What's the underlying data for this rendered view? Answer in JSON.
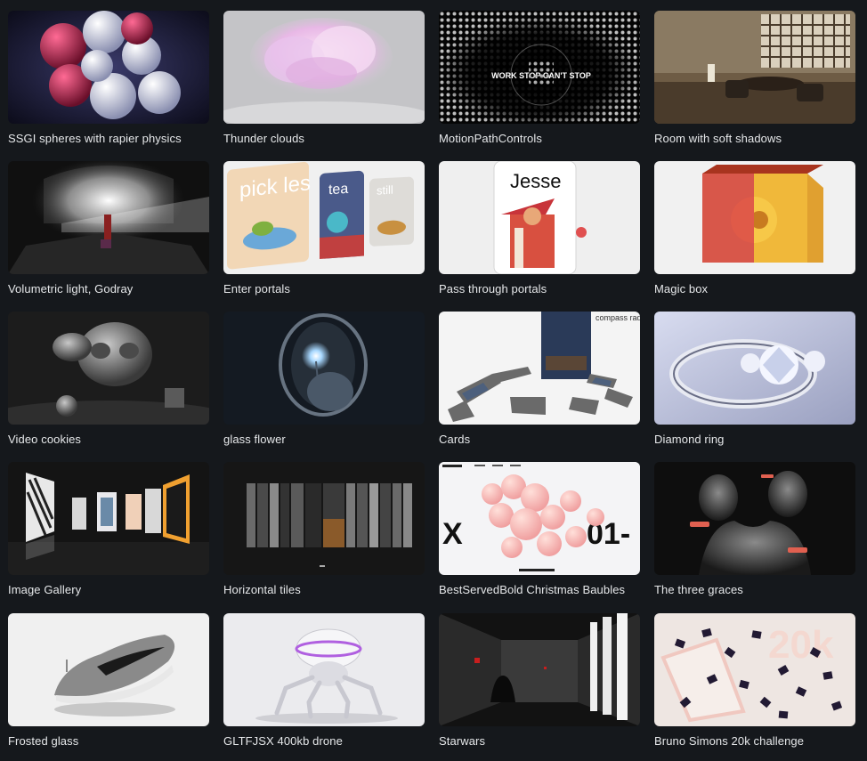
{
  "gallery": {
    "items": [
      {
        "title": "SSGI spheres with rapier physics"
      },
      {
        "title": "Thunder clouds"
      },
      {
        "title": "MotionPathControls"
      },
      {
        "title": "Room with soft shadows"
      },
      {
        "title": "Volumetric light, Godray"
      },
      {
        "title": "Enter portals"
      },
      {
        "title": "Pass through portals"
      },
      {
        "title": "Magic box"
      },
      {
        "title": "Video cookies"
      },
      {
        "title": "glass flower"
      },
      {
        "title": "Cards"
      },
      {
        "title": "Diamond ring"
      },
      {
        "title": "Image Gallery"
      },
      {
        "title": "Horizontal tiles"
      },
      {
        "title": "BestServedBold Christmas Baubles"
      },
      {
        "title": "The three graces"
      },
      {
        "title": "Frosted glass"
      },
      {
        "title": "GLTFJSX 400kb drone"
      },
      {
        "title": "Starwars"
      },
      {
        "title": "Bruno Simons 20k challenge"
      }
    ]
  },
  "thumbnail_text": {
    "motion_ring": "WORK STOP CAN'T STOP",
    "portal_pickles": "pick les",
    "portal_tea": "tea",
    "portal_still": "still",
    "portal_jesse": "Jesse",
    "cards_label": "compass rad",
    "baubles_left": "X",
    "baubles_right": "01-",
    "twenty_k": "20k"
  }
}
